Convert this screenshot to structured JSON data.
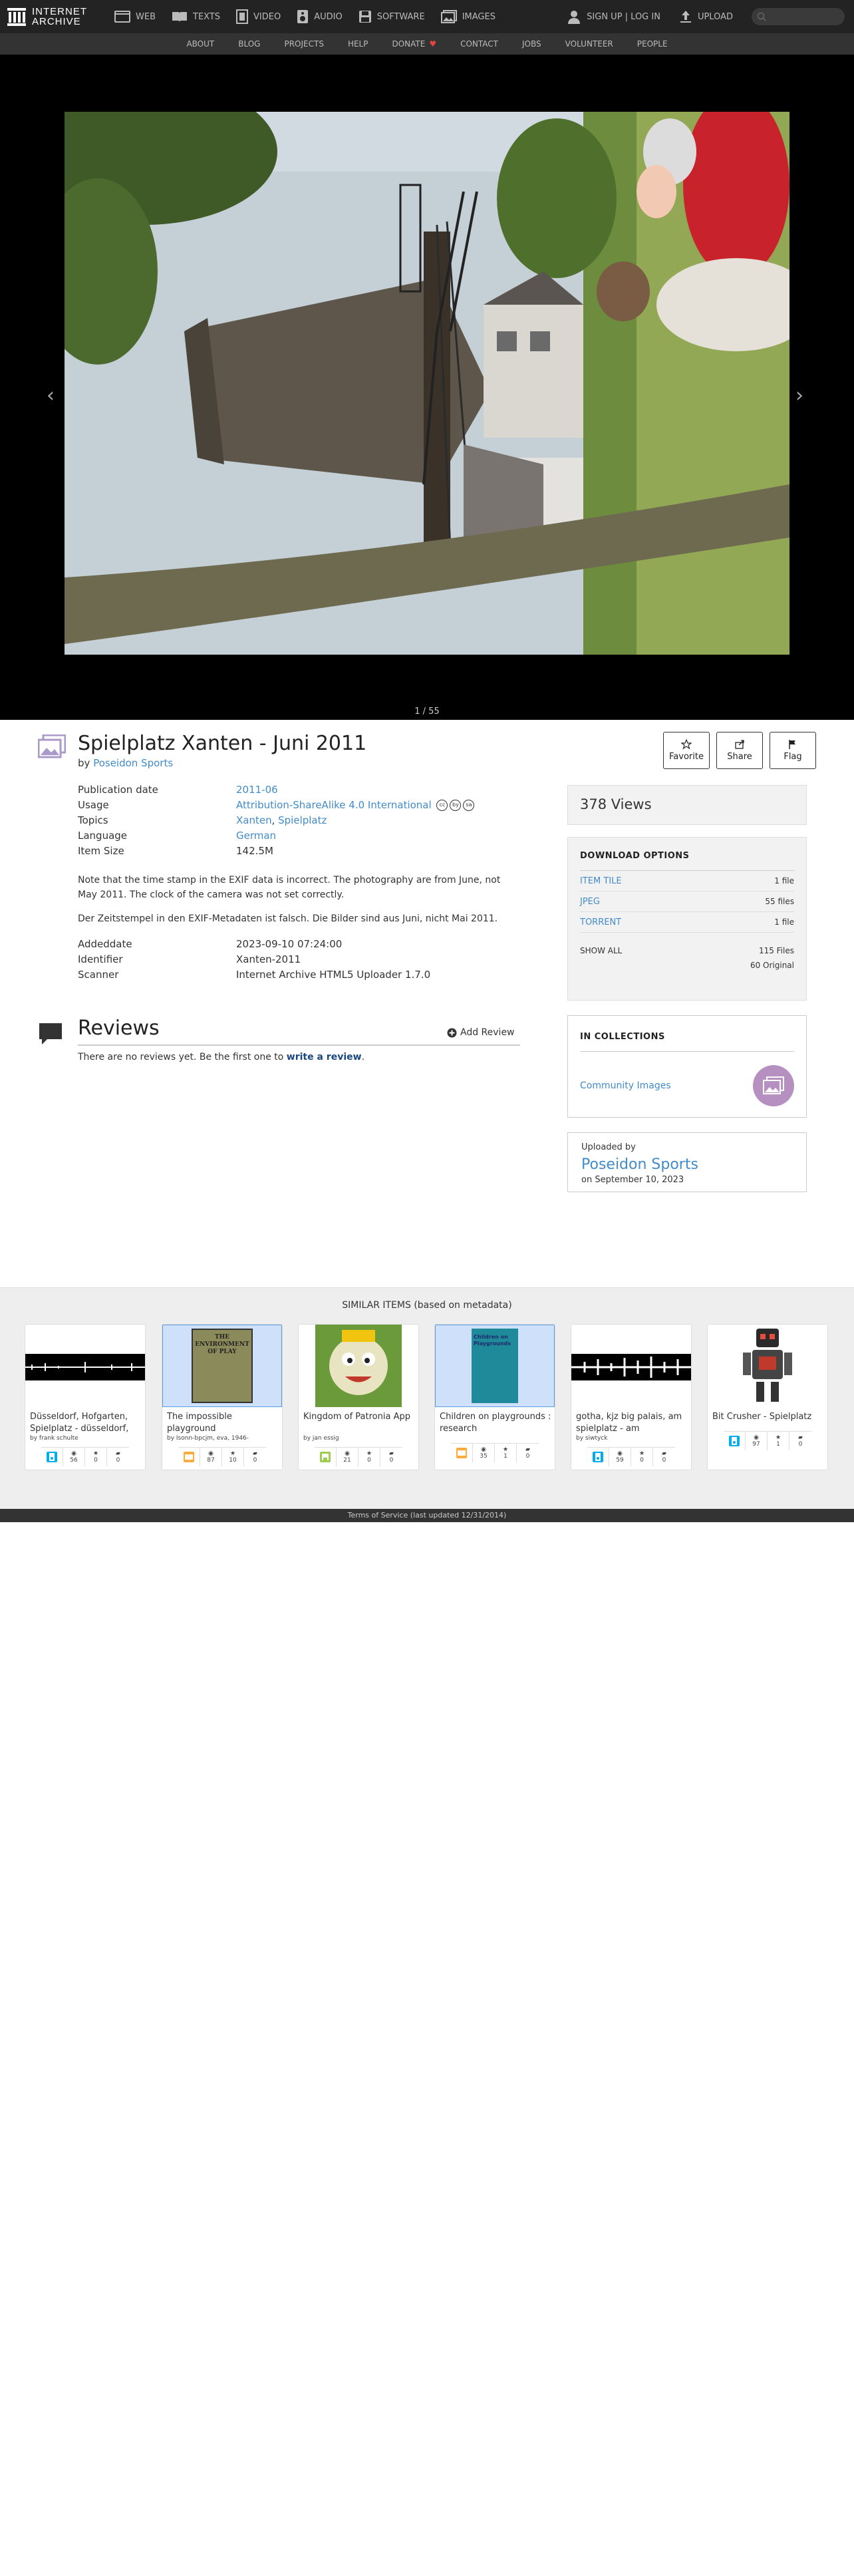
{
  "topnav": {
    "logo_line1": "INTERNET",
    "logo_line2": "ARCHIVE",
    "links": [
      "WEB",
      "TEXTS",
      "VIDEO",
      "AUDIO",
      "SOFTWARE",
      "IMAGES"
    ],
    "signup": "SIGN UP | LOG IN",
    "upload": "UPLOAD"
  },
  "subnav": [
    "ABOUT",
    "BLOG",
    "PROJECTS",
    "HELP",
    "DONATE",
    "CONTACT",
    "JOBS",
    "VOLUNTEER",
    "PEOPLE"
  ],
  "theater": {
    "counter": "1 / 55",
    "prev_arrow": "‹",
    "next_arrow": "›"
  },
  "item": {
    "title": "Spielplatz Xanten - Juni 2011",
    "by_label": "by",
    "author": "Poseidon Sports",
    "actions": [
      "Favorite",
      "Share",
      "Flag"
    ]
  },
  "metadata": {
    "publication_date_label": "Publication date",
    "publication_date": "2011-06",
    "usage_label": "Usage",
    "usage": "Attribution-ShareAlike 4.0 International",
    "cc_icons": [
      "cc",
      "by",
      "sa"
    ],
    "topics_label": "Topics",
    "topic_1": "Xanten",
    "topic_sep": ", ",
    "topic_2": "Spielplatz",
    "language_label": "Language",
    "language": "German",
    "size_label": "Item Size",
    "size": "142.5M"
  },
  "description": [
    "Note that the time stamp in the EXIF data is incorrect. The photography are from June, not May 2011. The clock of the camera was not set correctly.",
    "Der Zeitstempel in den EXIF-Metadaten ist falsch. Die Bilder sind aus Juni, nicht Mai 2011."
  ],
  "metadata2": {
    "addeddate_label": "Addeddate",
    "addeddate": "2023-09-10 07:24:00",
    "identifier_label": "Identifier",
    "identifier": "Xanten-2011",
    "scanner_label": "Scanner",
    "scanner": "Internet Archive HTML5 Uploader 1.7.0"
  },
  "reviews": {
    "title": "Reviews",
    "add": "Add Review",
    "note": "There are no reviews yet. Be the first one to",
    "link": "write a review",
    "period": "."
  },
  "sidebar": {
    "views": "378 Views",
    "download_head": "DOWNLOAD OPTIONS",
    "downloads": [
      {
        "name": "ITEM TILE",
        "count": "1 file"
      },
      {
        "name": "JPEG",
        "count": "55 files"
      },
      {
        "name": "TORRENT",
        "count": "1 file"
      }
    ],
    "show_all": "SHOW ALL",
    "total_files": "115 Files",
    "original": "60 Original",
    "collections_head": "IN COLLECTIONS",
    "collection": "Community Images",
    "uploaded_by_label": "Uploaded by",
    "uploader": "Poseidon Sports",
    "upload_date": "on September 10, 2023"
  },
  "similar": {
    "title": "SIMILAR ITEMS (based on metadata)",
    "items": [
      {
        "title": "Düsseldorf, Hofgarten, Spielplatz - düsseldorf,",
        "by": "by frank schulte",
        "type": "audio",
        "views": "56",
        "favs": "0",
        "reviews": "0"
      },
      {
        "title": "The impossible playground",
        "by": "by Isonn-bpcjm, eva, 1946-",
        "type": "texts",
        "views": "87",
        "favs": "10",
        "reviews": "0",
        "cover_text": "THE ENVIRONMENT OF PLAY"
      },
      {
        "title": "Kingdom of Patronia App",
        "by": "by jan essig",
        "type": "software",
        "views": "21",
        "favs": "0",
        "reviews": "0"
      },
      {
        "title": "Children on playgrounds : research",
        "by": "",
        "type": "texts",
        "views": "35",
        "favs": "1",
        "reviews": "0",
        "cover_text": "Children on Playgrounds"
      },
      {
        "title": "gotha, kjz big palais, am spielplatz - am",
        "by": "by siwtyck",
        "type": "audio",
        "views": "59",
        "favs": "0",
        "reviews": "0"
      },
      {
        "title": "Bit Crusher - Spielplatz",
        "by": "",
        "type": "audio",
        "views": "97",
        "favs": "1",
        "reviews": "0"
      }
    ]
  },
  "footer": "Terms of Service (last updated 12/31/2014)",
  "colors": {
    "link": "#428bca",
    "audio": "#00adef",
    "texts": "#faab3c",
    "software": "#9ecc4f",
    "images": "#aa99c9"
  }
}
